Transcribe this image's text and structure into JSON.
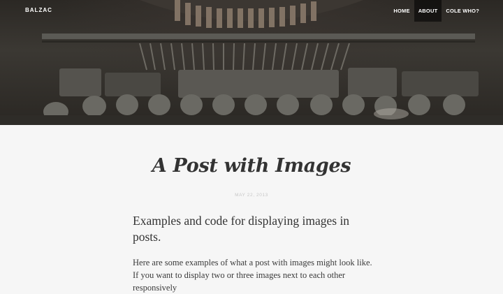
{
  "site": {
    "brand": "BALZAC"
  },
  "nav": {
    "items": [
      {
        "label": "HOME",
        "active": false
      },
      {
        "label": "ABOUT",
        "active": true
      },
      {
        "label": "COLE WHO?",
        "active": false
      }
    ]
  },
  "post": {
    "title": "A Post with Images",
    "date": "MAY 22, 2013",
    "lead": "Examples and code for displaying images in posts.",
    "body": "Here are some examples of what a post with images might look like. If you want to display two or three images next to each other responsively"
  },
  "colors": {
    "background": "#f6f6f6",
    "text": "#333333",
    "date": "#c7c7c7",
    "nav_text": "#ffffff"
  }
}
